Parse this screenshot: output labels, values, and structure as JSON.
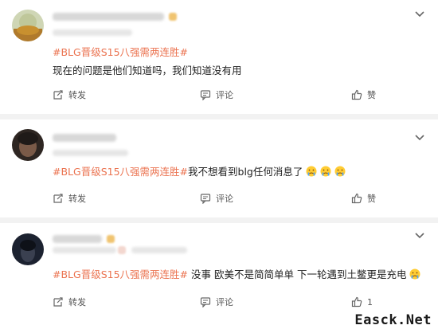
{
  "posts": [
    {
      "hashtag": "#BLG晋级S15八强需两连胜#",
      "text": "",
      "line": "现在的问题是他们知道吗，我们知道没有用",
      "emoji_count": 0,
      "actions": {
        "repost": "转发",
        "comment": "评论",
        "like": "赞"
      }
    },
    {
      "hashtag": "#BLG晋级S15八强需两连胜#",
      "text": "我不想看到blg任何消息了",
      "emoji_count": 3,
      "actions": {
        "repost": "转发",
        "comment": "评论",
        "like": "赞"
      }
    },
    {
      "hashtag": "#BLG晋级S15八强需两连胜#",
      "text": "没事 欧美不是简简单单 下一轮遇到土鳖更是充电",
      "emoji_count": 1,
      "actions": {
        "repost": "转发",
        "comment": "评论",
        "like": "1"
      }
    }
  ],
  "watermark": "Easck.Net",
  "colors": {
    "hashtag": "#eb7350",
    "divider": "#f2f2f2",
    "text": "#222222"
  }
}
